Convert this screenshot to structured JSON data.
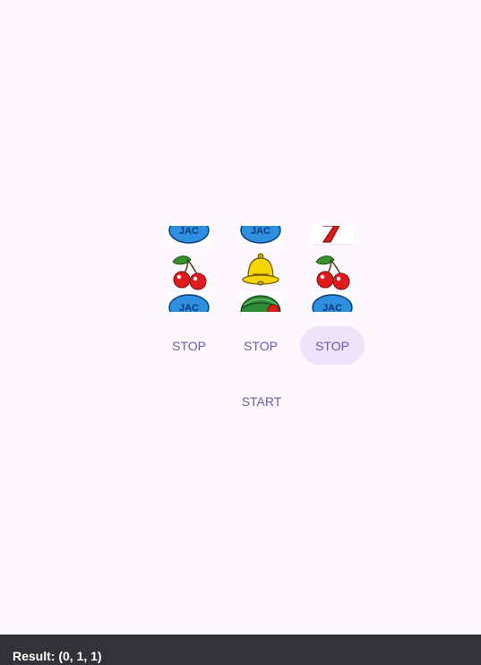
{
  "reels": [
    {
      "symbols": [
        "jac-icon",
        "cherry-icon",
        "jac-icon"
      ]
    },
    {
      "symbols": [
        "jac-icon",
        "bell-icon",
        "watermelon-icon"
      ]
    },
    {
      "symbols": [
        "seven-icon",
        "cherry-icon",
        "jac-icon"
      ]
    }
  ],
  "buttons": {
    "stop_labels": [
      "STOP",
      "STOP",
      "STOP"
    ],
    "start_label": "START"
  },
  "result": {
    "text": "Result: (0, 1, 1)"
  },
  "colors": {
    "background": "#fcf8fe",
    "accent": "#6b5ca5",
    "active_button_bg": "#ece3fa",
    "result_bar_bg": "#333236"
  }
}
